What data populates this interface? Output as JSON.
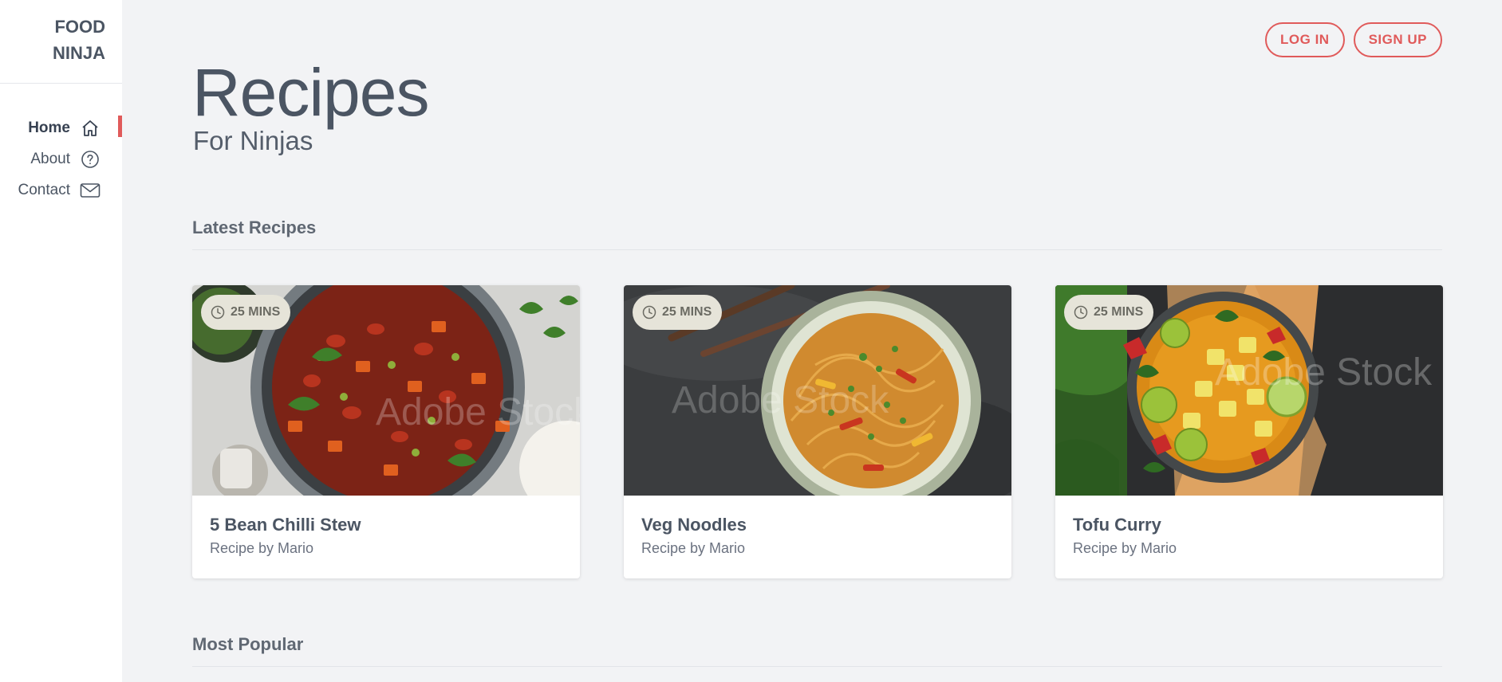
{
  "brand": {
    "line1": "FOOD",
    "line2": "NINJA"
  },
  "nav": [
    {
      "label": "Home",
      "icon": "home-icon",
      "active": true
    },
    {
      "label": "About",
      "icon": "question-circle-icon",
      "active": false
    },
    {
      "label": "Contact",
      "icon": "mail-icon",
      "active": false
    }
  ],
  "auth": {
    "login_label": "LOG IN",
    "signup_label": "SIGN UP"
  },
  "header": {
    "title": "Recipes",
    "subtitle": "For Ninjas"
  },
  "sections": {
    "latest": "Latest Recipes",
    "popular": "Most Popular"
  },
  "recipes": [
    {
      "title": "5 Bean Chilli Stew",
      "author": "Recipe by Mario",
      "time": "25 MINS",
      "image": "bean-chilli-stew-photo"
    },
    {
      "title": "Veg Noodles",
      "author": "Recipe by Mario",
      "time": "25 MINS",
      "image": "veg-noodles-photo"
    },
    {
      "title": "Tofu Curry",
      "author": "Recipe by Mario",
      "time": "25 MINS",
      "image": "tofu-curry-photo"
    }
  ],
  "colors": {
    "accent": "#e05a5a",
    "background": "#f2f3f5",
    "sidebar": "#ffffff",
    "text": "#4b5563",
    "badge": "#e6e4d9"
  }
}
